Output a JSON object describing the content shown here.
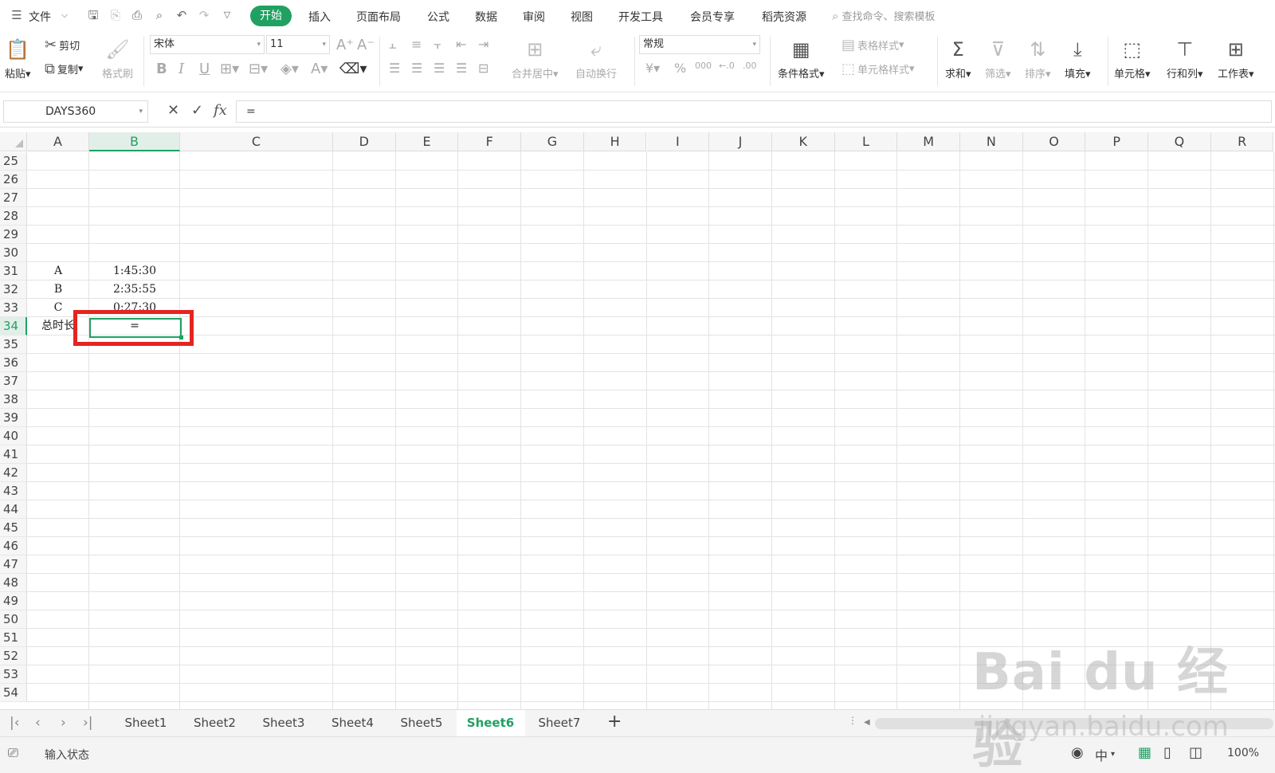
{
  "menubar": {
    "file_label": "文件",
    "tabs": [
      "开始",
      "插入",
      "页面布局",
      "公式",
      "数据",
      "审阅",
      "视图",
      "开发工具",
      "会员专享",
      "稻壳资源"
    ],
    "search_placeholder": "查找命令、搜索模板"
  },
  "ribbon": {
    "paste": "粘贴",
    "cut": "剪切",
    "copy": "复制",
    "format_painter": "格式刷",
    "font_name": "宋体",
    "font_size": "11",
    "merge_center": "合并居中",
    "wrap_text": "自动换行",
    "number_format": "常规",
    "conditional_format": "条件格式",
    "table_style": "表格样式",
    "cell_style": "单元格样式",
    "sum": "求和",
    "filter": "筛选",
    "sort": "排序",
    "fill": "填充",
    "cell": "单元格",
    "row_col": "行和列",
    "worksheet": "工作表",
    "bold": "B",
    "italic": "I",
    "underline": "U"
  },
  "formula_bar": {
    "name_box": "DAYS360",
    "content": "=",
    "fx": "fx"
  },
  "grid": {
    "columns": [
      "A",
      "B",
      "C",
      "D",
      "E",
      "F",
      "G",
      "H",
      "I",
      "J",
      "K",
      "L",
      "M",
      "N",
      "O",
      "P",
      "Q",
      "R"
    ],
    "rows": [
      "25",
      "26",
      "27",
      "28",
      "29",
      "30",
      "31",
      "32",
      "33",
      "34",
      "35",
      "36",
      "37",
      "38",
      "39",
      "40",
      "41",
      "42",
      "43",
      "44",
      "45",
      "46",
      "47",
      "48",
      "49",
      "50",
      "51",
      "52",
      "53",
      "54"
    ],
    "selected_column": "B",
    "selected_row": "34",
    "cells": {
      "A31": "A",
      "B31": "1:45:30",
      "A32": "B",
      "B32": "2:35:55",
      "A33": "C",
      "B33": "0:27:30",
      "A34": "总时长",
      "B34": "="
    }
  },
  "sheets": {
    "tabs": [
      "Sheet1",
      "Sheet2",
      "Sheet3",
      "Sheet4",
      "Sheet5",
      "Sheet6",
      "Sheet7"
    ],
    "active": "Sheet6"
  },
  "status": {
    "mode": "输入状态",
    "ime": "中",
    "zoom": "100%"
  },
  "watermark": {
    "logo": "Bai du 经验",
    "url": "jingyan.baidu.com"
  },
  "colors": {
    "accent": "#20a162",
    "highlight": "#e52420"
  }
}
